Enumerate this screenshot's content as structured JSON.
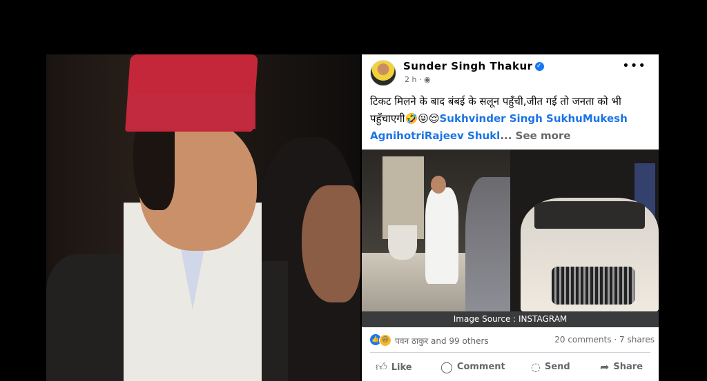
{
  "post": {
    "author": "Sunder Singh Thakur",
    "time": "2 h · ",
    "text_prefix": "टिकट मिलने के बाद बंबई के सलून पहुँची,जीत गई तो जनता को भी पहुँचाएगी🤣😜😌",
    "tag1": "Sukhvinder Singh Sukhu",
    "tag2": "Mukesh Agnihotri",
    "tag3": "Rajeev Shukl",
    "see_more": "... See more",
    "image_caption": "Image Source : INSTAGRAM",
    "reactions_text": "पवन ठाकुर and 99 others",
    "counts_text": "20 comments · 7 shares"
  },
  "actions": {
    "like": "Like",
    "comment": "Comment",
    "send": "Send",
    "share": "Share"
  },
  "icons": {
    "verified": "verified-badge-icon",
    "more": "more-options-icon",
    "globe": "globe-icon",
    "like": "thumbs-up-icon",
    "comment": "comment-bubble-icon",
    "send": "messenger-icon",
    "share": "share-arrow-icon"
  },
  "colors": {
    "link": "#1b74e4",
    "verified": "#1877f2"
  }
}
